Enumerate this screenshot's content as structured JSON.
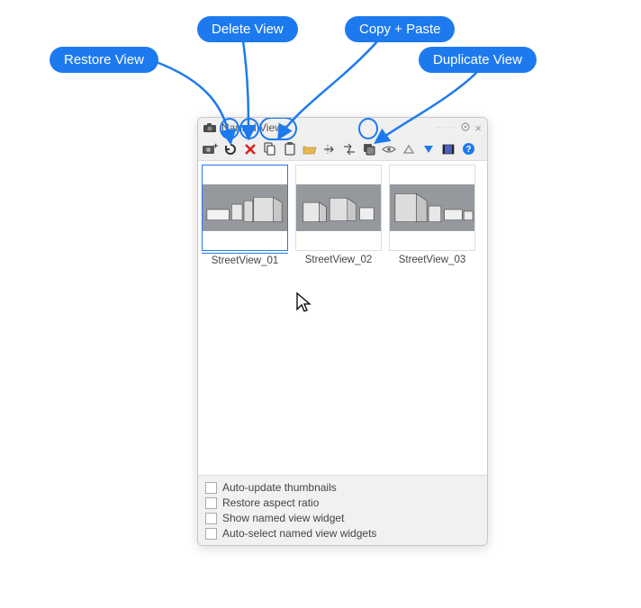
{
  "callouts": {
    "restore": "Restore View",
    "delete": "Delete View",
    "copypaste": "Copy + Paste",
    "duplicate": "Duplicate View"
  },
  "panel": {
    "title": "Named Views"
  },
  "toolbar": {
    "new": "new-view",
    "restore": "restore-view",
    "delete": "delete-view",
    "copy": "copy",
    "paste": "paste",
    "open": "open",
    "select_arrow": "select-arrow",
    "double_arrow": "reflect-arrows",
    "duplicate": "duplicate-view",
    "eye": "visibility",
    "tri_up": "up",
    "tri_down": "down",
    "film": "animation",
    "help": "help"
  },
  "views": [
    {
      "label": "StreetView_01",
      "selected": true
    },
    {
      "label": "StreetView_02",
      "selected": false
    },
    {
      "label": "StreetView_03",
      "selected": false
    }
  ],
  "options": {
    "auto_update": "Auto-update thumbnails",
    "restore_aspect": "Restore aspect ratio",
    "show_widget": "Show named view widget",
    "auto_select": "Auto-select named view widgets"
  }
}
